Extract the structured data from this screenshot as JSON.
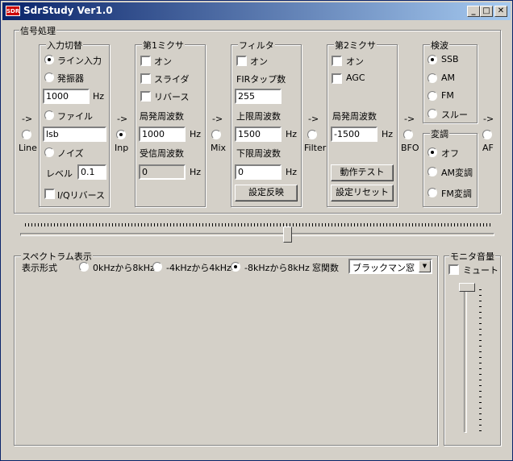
{
  "window": {
    "title": "SdrStudy  Ver1.0",
    "icon_text": "SDR",
    "minimize": "_",
    "maximize": "□",
    "close": "✕"
  },
  "signal": {
    "title": "信号処理",
    "arrow": "->",
    "nodes": {
      "line": "Line",
      "inp": "Inp",
      "mix": "Mix",
      "filter": "Filter",
      "bfo": "BFO",
      "af": "AF"
    },
    "input": {
      "title": "入力切替",
      "line_input": "ライン入力",
      "oscillator": "発振器",
      "osc_freq": "1000",
      "hz": "Hz",
      "file": "ファイル",
      "file_name": "lsb",
      "noise": "ノイズ",
      "level_label": "レベル",
      "level": "0.1",
      "iq_reverse": "I/Qリバース"
    },
    "mixer1": {
      "title": "第1ミクサ",
      "on": "オン",
      "slider": "スライダ",
      "reverse": "リバース",
      "lo_label": "局発周波数",
      "lo_freq": "1000",
      "hz": "Hz",
      "rx_label": "受信周波数",
      "rx_freq": "0",
      "hz2": "Hz"
    },
    "filter": {
      "title": "フィルタ",
      "on": "オン",
      "taps_label": "FIRタップ数",
      "taps": "255",
      "upper_label": "上限周波数",
      "upper": "1500",
      "hz": "Hz",
      "lower_label": "下限周波数",
      "lower": "0",
      "hz2": "Hz",
      "apply_button": "設定反映"
    },
    "mixer2": {
      "title": "第2ミクサ",
      "on": "オン",
      "agc": "AGC",
      "lo_label": "局発周波数",
      "lo_freq": "-1500",
      "hz": "Hz",
      "test_button": "動作テスト",
      "reset_button": "設定リセット"
    },
    "detect": {
      "title": "検波",
      "ssb": "SSB",
      "am": "AM",
      "fm": "FM",
      "through": "スルー"
    },
    "modulation": {
      "title": "変調",
      "off": "オフ",
      "am": "AM変調",
      "fm": "FM変調"
    }
  },
  "spectrum": {
    "title": "スペクトラム表示",
    "format_label": "表示形式",
    "range1": "0kHzから8kHz",
    "range2": "-4kHzから4kHz",
    "range3": "-8kHzから8kHz",
    "window_label": "窓関数",
    "window_value": "ブラックマン窓"
  },
  "monitor": {
    "title": "モニタ音量",
    "mute": "ミュート"
  }
}
